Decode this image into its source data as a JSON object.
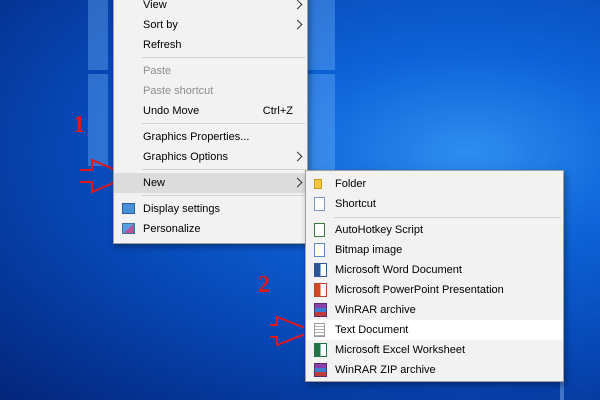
{
  "context_menu": {
    "items": [
      {
        "label": "View",
        "submenu": true
      },
      {
        "label": "Sort by",
        "submenu": true
      },
      {
        "label": "Refresh"
      },
      {
        "label": "Paste",
        "disabled": true
      },
      {
        "label": "Paste shortcut",
        "disabled": true
      },
      {
        "label": "Undo Move",
        "shortcut": "Ctrl+Z"
      },
      {
        "label": "Graphics Properties..."
      },
      {
        "label": "Graphics Options",
        "submenu": true
      },
      {
        "label": "New",
        "submenu": true
      },
      {
        "label": "Display settings",
        "icon": "display-settings-icon"
      },
      {
        "label": "Personalize",
        "icon": "personalize-icon"
      }
    ]
  },
  "new_submenu": {
    "items": [
      {
        "label": "Folder",
        "icon": "folder-icon"
      },
      {
        "label": "Shortcut",
        "icon": "shortcut-icon"
      },
      {
        "label": "AutoHotkey Script",
        "icon": "autohotkey-icon"
      },
      {
        "label": "Bitmap image",
        "icon": "bitmap-icon"
      },
      {
        "label": "Microsoft Word Document",
        "icon": "word-icon"
      },
      {
        "label": "Microsoft PowerPoint Presentation",
        "icon": "powerpoint-icon"
      },
      {
        "label": "WinRAR archive",
        "icon": "winrar-icon"
      },
      {
        "label": "Text Document",
        "icon": "text-document-icon"
      },
      {
        "label": "Microsoft Excel Worksheet",
        "icon": "excel-icon"
      },
      {
        "label": "WinRAR ZIP archive",
        "icon": "winrar-zip-icon"
      }
    ]
  },
  "annotations": {
    "step1": "1",
    "step2": "2"
  },
  "colors": {
    "desktop": "#0d63d8",
    "annotation": "#e0181b",
    "menu_bg": "#f2f2f2"
  }
}
